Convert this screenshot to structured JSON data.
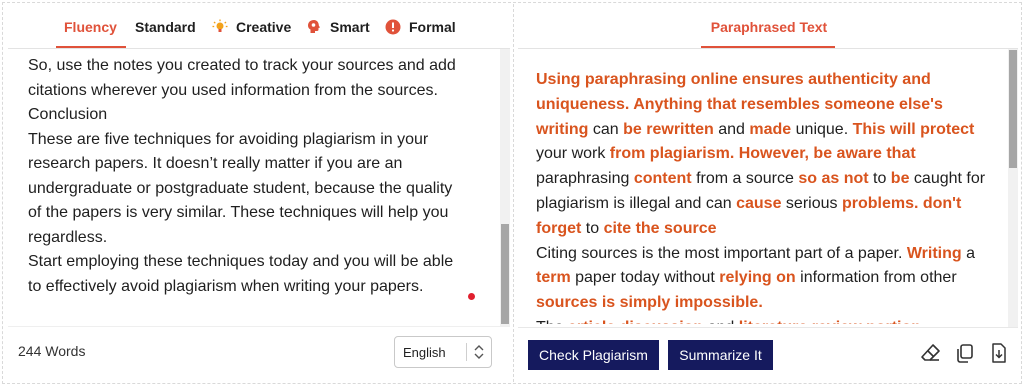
{
  "tabs": [
    {
      "label": "Fluency",
      "icon": null,
      "active": true
    },
    {
      "label": "Standard",
      "icon": null,
      "active": false
    },
    {
      "label": "Creative",
      "icon": "lightbulb-icon",
      "active": false
    },
    {
      "label": "Smart",
      "icon": "brain-icon",
      "active": false
    },
    {
      "label": "Formal",
      "icon": "info-circle-icon",
      "active": false
    }
  ],
  "editor": {
    "paragraphs": [
      "So, use the notes you created to track your sources and add citations wherever you used information from the sources.",
      "Conclusion",
      "These are five techniques for avoiding plagiarism in your research papers. It doesn’t really matter if you are an undergraduate or postgraduate student, because the quality of the papers is very similar. These techniques will help you regardless.",
      "Start employing these techniques today and you will be able to effectively avoid plagiarism when writing your papers."
    ]
  },
  "footer_left": {
    "word_count": "244 Words",
    "language": "English"
  },
  "output_tab": "Paraphrased Text",
  "output": {
    "paragraph1": [
      {
        "text": "Using paraphrasing online ensures authenticity and uniqueness. Anything that resembles someone else's writing",
        "changed": true
      },
      {
        "text": " can ",
        "changed": false
      },
      {
        "text": "be rewritten",
        "changed": true
      },
      {
        "text": " and ",
        "changed": false
      },
      {
        "text": "made",
        "changed": true
      },
      {
        "text": " unique. ",
        "changed": false
      },
      {
        "text": "This will protect",
        "changed": true
      },
      {
        "text": " your work ",
        "changed": false
      },
      {
        "text": "from plagiarism. However, be aware that",
        "changed": true
      },
      {
        "text": " paraphrasing ",
        "changed": false
      },
      {
        "text": "content",
        "changed": true
      },
      {
        "text": " from a source ",
        "changed": false
      },
      {
        "text": "so as not",
        "changed": true
      },
      {
        "text": " to ",
        "changed": false
      },
      {
        "text": "be",
        "changed": true
      },
      {
        "text": " caught for plagiarism is illegal and can ",
        "changed": false
      },
      {
        "text": "cause",
        "changed": true
      },
      {
        "text": " serious ",
        "changed": false
      },
      {
        "text": "problems. don't forget",
        "changed": true
      },
      {
        "text": " to ",
        "changed": false
      },
      {
        "text": "cite the source",
        "changed": true
      }
    ],
    "paragraph2": [
      {
        "text": "Citing sources is the most important part of a paper. ",
        "changed": false
      },
      {
        "text": "Writing",
        "changed": true
      },
      {
        "text": " a ",
        "changed": false
      },
      {
        "text": "term",
        "changed": true
      },
      {
        "text": " paper today without ",
        "changed": false
      },
      {
        "text": "relying on",
        "changed": true
      },
      {
        "text": " information from other ",
        "changed": false
      },
      {
        "text": "sources is simply impossible.",
        "changed": true
      }
    ],
    "paragraph3": [
      {
        "text": "The ",
        "changed": false
      },
      {
        "text": "article discussion",
        "changed": true
      },
      {
        "text": " and ",
        "changed": false
      },
      {
        "text": "literature review portion",
        "changed": true
      }
    ]
  },
  "buttons": {
    "check_plagiarism": "Check Plagiarism",
    "summarize": "Summarize It"
  },
  "colors": {
    "accent": "#e0523a",
    "highlight_text": "#d9541e",
    "button_bg": "#151a5e",
    "caret_dot": "#e0202f"
  }
}
